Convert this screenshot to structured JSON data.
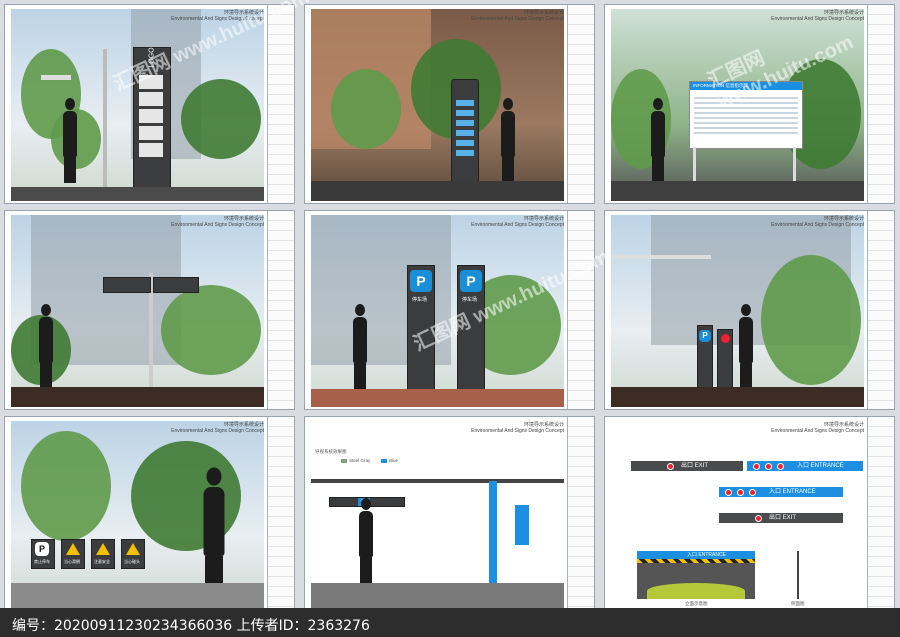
{
  "sheet_caption": {
    "line1": "环境导示系统设计",
    "line2": "Environmental And Signs Design Concept"
  },
  "panel1": {
    "logo_text": "LOGO"
  },
  "panel3": {
    "board_title": "INFORMATION 信息指示牌"
  },
  "panel5": {
    "sign1_label": "停车场",
    "sign2_label": "停车场",
    "p": "P"
  },
  "panel6": {
    "p": "P"
  },
  "panel7": {
    "p": "P",
    "sign_labels": [
      "禁止停车",
      "当心滑倒",
      "注意安全",
      "当心碰头"
    ]
  },
  "panel8": {
    "title": "导视系统效果图",
    "legend1": "Steel Gray",
    "legend2": "Blue",
    "mark": "32"
  },
  "panel9": {
    "strip1": "出口 EXIT",
    "strip2": "入口 ENTRANCE",
    "strip3": "入口 ENTRANCE",
    "strip4": "出口 EXIT",
    "garage_banner": "入口 ENTRANCE",
    "garage_caption": "立面示意图",
    "side_caption": "侧面图"
  },
  "footer": {
    "text": "编号：20200911230234366036 上传者ID：2363276"
  },
  "watermark": "汇图网 www.huitu.com"
}
